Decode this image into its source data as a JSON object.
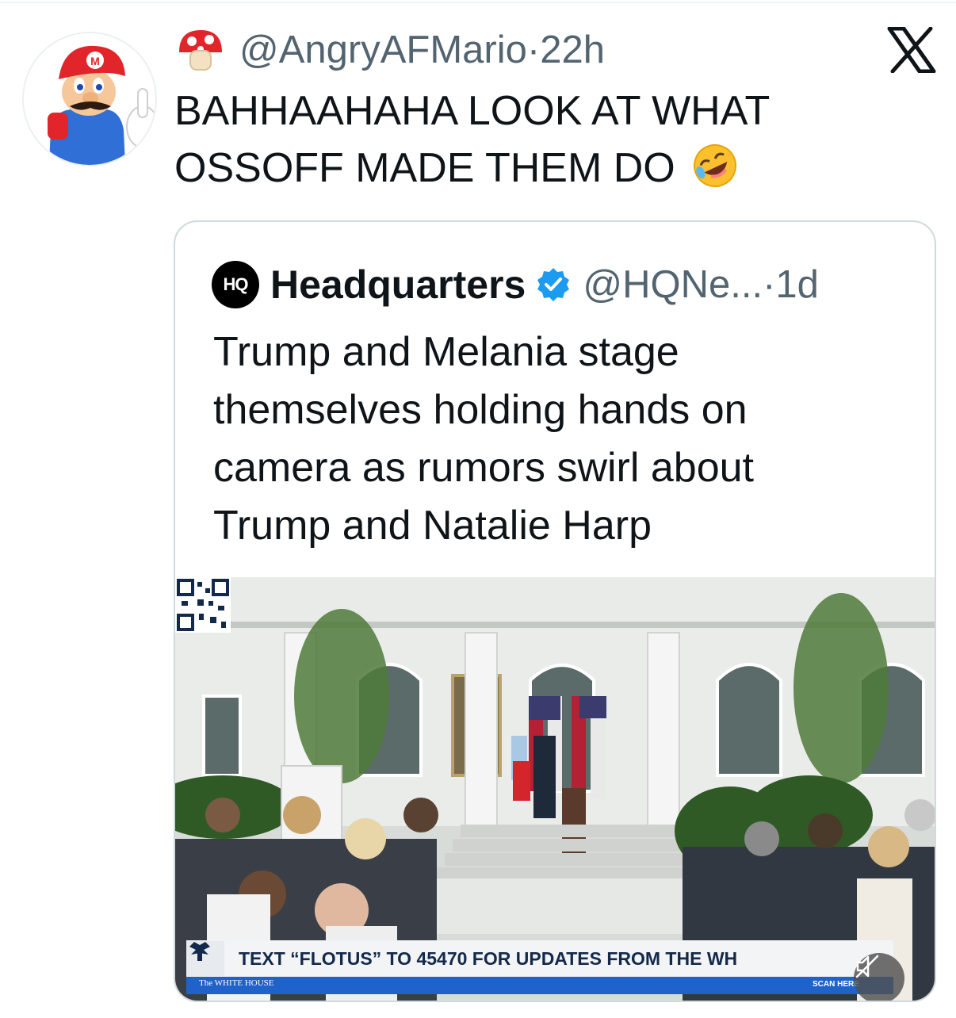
{
  "tweet": {
    "avatar_icon": "mario-avatar-icon",
    "badge_icon": "mushroom-icon",
    "handle_time": "@AngryAFMario·22h",
    "text": "BAHHAAHAHA LOOK AT WHAT\nOSSOFF MADE THEM DO",
    "emoji_icon": "rolling-on-floor-laughing-icon"
  },
  "platform": {
    "logo_icon": "x-logo-icon"
  },
  "quoted_tweet": {
    "logo_text": "HQ",
    "name": "Headquarters",
    "verified_icon": "verified-badge-icon",
    "verified_color": "#1d9bf0",
    "handle_time": "@HQNe...·1d",
    "text": "Trump and Melania stage\nthemselves holding hands on\ncamera as rumors swirl about\nTrump and Natalie Harp",
    "media": {
      "ticker_text": "TEXT “FLOTUS” TO 45470 FOR UPDATES FROM THE WH",
      "network_label": "The WHITE HOUSE",
      "scan_label": "SCAN HERE",
      "mute_icon": "mute-icon",
      "qr_icon": "qr-code-icon"
    }
  }
}
